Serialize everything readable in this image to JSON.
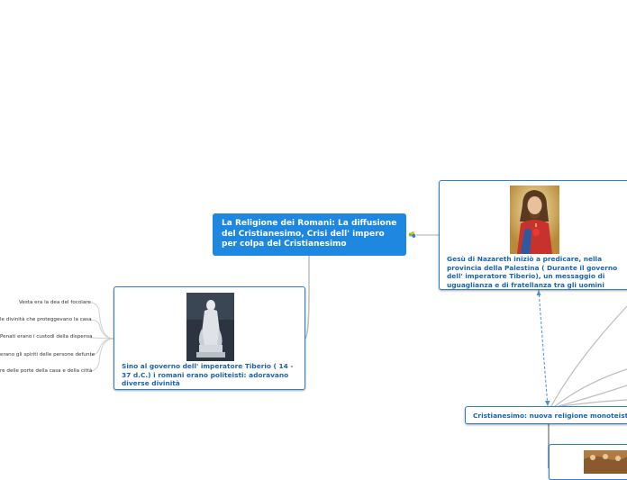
{
  "central_topic": {
    "title": "La Religione dei Romani: La diffusione del Cristianesimo, Crisi dell' impero per colpa del Cristianesimo"
  },
  "nodes": {
    "romani": {
      "text": "Sino al governo dell' imperatore Tiberio ( 14 - 37 d.C.) i romani erano politeisti: adoravano diverse divinità",
      "image": "statue-image"
    },
    "gesu": {
      "text": "Gesù di Nazareth iniziò a predicare, nella provincia della Palestina ( Durante il governo dell' imperatore Tiberio), un messaggio di uguaglianza e di fratellanza tra gli uomini",
      "image": "jesus-portrait-image"
    },
    "cristianesimo": {
      "text": "Cristianesimo: nuova religione monoteista."
    }
  },
  "leaves": [
    "Vesta era la dea del focolare",
    "le divinità che proteggevano la casa",
    "Penati erano i custodi della dispensa",
    "erano gli spiriti delle persone defunte",
    "re delle porte della casa e della città"
  ],
  "colors": {
    "central_bg": "#1e88e0",
    "node_border": "#2f7fc9",
    "node_text": "#1b62b0",
    "connector": "#bfbfbf"
  }
}
